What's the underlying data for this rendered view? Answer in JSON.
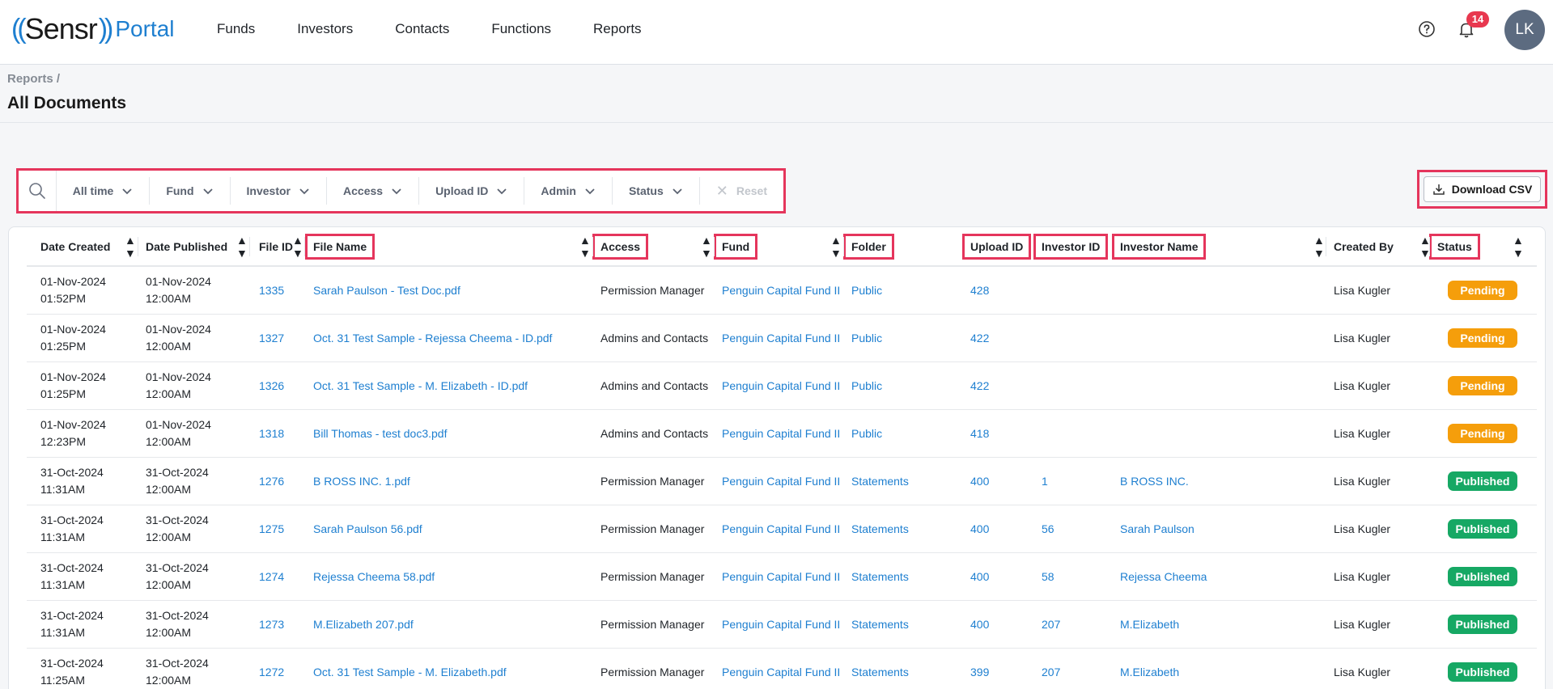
{
  "app": {
    "logo_paren_left": "((",
    "logo_name": "Sensr",
    "logo_paren_right": "))",
    "logo_suffix": "Portal"
  },
  "nav": [
    "Funds",
    "Investors",
    "Contacts",
    "Functions",
    "Reports"
  ],
  "notifications": {
    "count": "14"
  },
  "user": {
    "initials": "LK"
  },
  "breadcrumb": "Reports /",
  "page_title": "All Documents",
  "filters": {
    "items": [
      "All time",
      "Fund",
      "Investor",
      "Access",
      "Upload ID",
      "Admin",
      "Status"
    ],
    "reset": "Reset"
  },
  "download_csv": "Download CSV",
  "columns": [
    "Date Created",
    "Date Published",
    "File ID",
    "File Name",
    "Access",
    "Fund",
    "Folder",
    "Upload ID",
    "Investor ID",
    "Investor Name",
    "Created By",
    "Status"
  ],
  "rows": [
    {
      "created_date": "01-Nov-2024",
      "created_time": "01:52PM",
      "pub_date": "01-Nov-2024",
      "pub_time": "12:00AM",
      "file_id": "1335",
      "file_name": "Sarah Paulson - Test Doc.pdf",
      "access": "Permission Manager",
      "fund": "Penguin Capital Fund II",
      "folder": "Public",
      "upload_id": "428",
      "investor_id": "",
      "investor_name": "",
      "created_by": "Lisa Kugler",
      "status": "Pending"
    },
    {
      "created_date": "01-Nov-2024",
      "created_time": "01:25PM",
      "pub_date": "01-Nov-2024",
      "pub_time": "12:00AM",
      "file_id": "1327",
      "file_name": "Oct. 31 Test Sample - Rejessa Cheema - ID.pdf",
      "access": "Admins and Contacts",
      "fund": "Penguin Capital Fund II",
      "folder": "Public",
      "upload_id": "422",
      "investor_id": "",
      "investor_name": "",
      "created_by": "Lisa Kugler",
      "status": "Pending"
    },
    {
      "created_date": "01-Nov-2024",
      "created_time": "01:25PM",
      "pub_date": "01-Nov-2024",
      "pub_time": "12:00AM",
      "file_id": "1326",
      "file_name": "Oct. 31 Test Sample - M. Elizabeth - ID.pdf",
      "access": "Admins and Contacts",
      "fund": "Penguin Capital Fund II",
      "folder": "Public",
      "upload_id": "422",
      "investor_id": "",
      "investor_name": "",
      "created_by": "Lisa Kugler",
      "status": "Pending"
    },
    {
      "created_date": "01-Nov-2024",
      "created_time": "12:23PM",
      "pub_date": "01-Nov-2024",
      "pub_time": "12:00AM",
      "file_id": "1318",
      "file_name": "Bill Thomas - test doc3.pdf",
      "access": "Admins and Contacts",
      "fund": "Penguin Capital Fund II",
      "folder": "Public",
      "upload_id": "418",
      "investor_id": "",
      "investor_name": "",
      "created_by": "Lisa Kugler",
      "status": "Pending"
    },
    {
      "created_date": "31-Oct-2024",
      "created_time": "11:31AM",
      "pub_date": "31-Oct-2024",
      "pub_time": "12:00AM",
      "file_id": "1276",
      "file_name": "B ROSS INC. 1.pdf",
      "access": "Permission Manager",
      "fund": "Penguin Capital Fund II",
      "folder": "Statements",
      "upload_id": "400",
      "investor_id": "1",
      "investor_name": "B ROSS INC.",
      "created_by": "Lisa Kugler",
      "status": "Published"
    },
    {
      "created_date": "31-Oct-2024",
      "created_time": "11:31AM",
      "pub_date": "31-Oct-2024",
      "pub_time": "12:00AM",
      "file_id": "1275",
      "file_name": "Sarah Paulson 56.pdf",
      "access": "Permission Manager",
      "fund": "Penguin Capital Fund II",
      "folder": "Statements",
      "upload_id": "400",
      "investor_id": "56",
      "investor_name": "Sarah Paulson",
      "created_by": "Lisa Kugler",
      "status": "Published"
    },
    {
      "created_date": "31-Oct-2024",
      "created_time": "11:31AM",
      "pub_date": "31-Oct-2024",
      "pub_time": "12:00AM",
      "file_id": "1274",
      "file_name": "Rejessa Cheema 58.pdf",
      "access": "Permission Manager",
      "fund": "Penguin Capital Fund II",
      "folder": "Statements",
      "upload_id": "400",
      "investor_id": "58",
      "investor_name": "Rejessa Cheema",
      "created_by": "Lisa Kugler",
      "status": "Published"
    },
    {
      "created_date": "31-Oct-2024",
      "created_time": "11:31AM",
      "pub_date": "31-Oct-2024",
      "pub_time": "12:00AM",
      "file_id": "1273",
      "file_name": "M.Elizabeth 207.pdf",
      "access": "Permission Manager",
      "fund": "Penguin Capital Fund II",
      "folder": "Statements",
      "upload_id": "400",
      "investor_id": "207",
      "investor_name": "M.Elizabeth",
      "created_by": "Lisa Kugler",
      "status": "Published"
    },
    {
      "created_date": "31-Oct-2024",
      "created_time": "11:25AM",
      "pub_date": "31-Oct-2024",
      "pub_time": "12:00AM",
      "file_id": "1272",
      "file_name": "Oct. 31 Test Sample - M. Elizabeth.pdf",
      "access": "Permission Manager",
      "fund": "Penguin Capital Fund II",
      "folder": "Statements",
      "upload_id": "399",
      "investor_id": "207",
      "investor_name": "M.Elizabeth",
      "created_by": "Lisa Kugler",
      "status": "Published"
    }
  ],
  "colors": {
    "link": "#1e7fd0",
    "highlight": "#e5355c",
    "pending": "#f59e0b",
    "published": "#16a864"
  }
}
